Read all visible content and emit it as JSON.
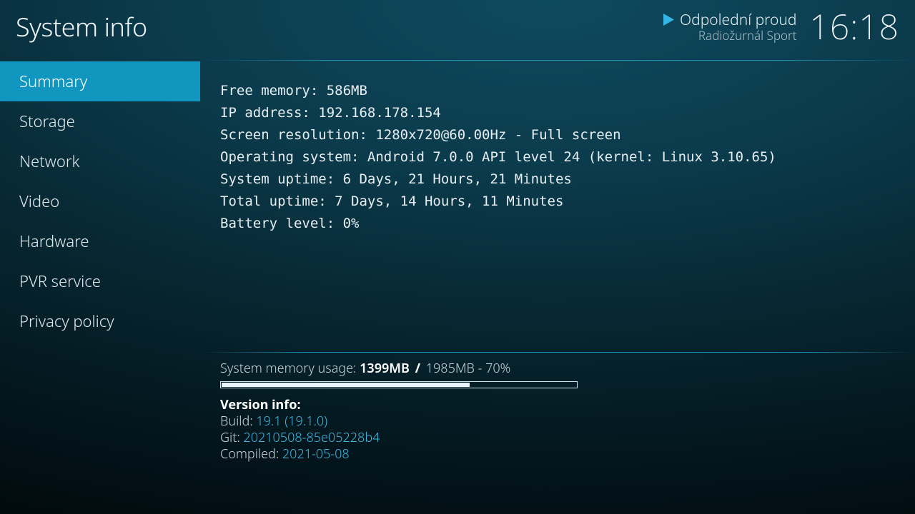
{
  "header": {
    "title": "System info",
    "now_playing": {
      "line1": "Odpolední proud",
      "line2": "Radiožurnál Sport"
    },
    "clock": "16:18"
  },
  "sidebar": {
    "items": [
      {
        "label": "Summary",
        "selected": true
      },
      {
        "label": "Storage",
        "selected": false
      },
      {
        "label": "Network",
        "selected": false
      },
      {
        "label": "Video",
        "selected": false
      },
      {
        "label": "Hardware",
        "selected": false
      },
      {
        "label": "PVR service",
        "selected": false
      },
      {
        "label": "Privacy policy",
        "selected": false
      }
    ]
  },
  "summary": {
    "lines": [
      "Free memory: 586MB",
      "IP address: 192.168.178.154",
      "Screen resolution: 1280x720@60.00Hz - Full screen",
      "Operating system: Android 7.0.0 API level 24 (kernel: Linux 3.10.65)",
      "System uptime: 6 Days, 21 Hours, 21 Minutes",
      "Total uptime: 7 Days, 14 Hours, 11 Minutes",
      "Battery level: 0%"
    ]
  },
  "footer": {
    "memory": {
      "label": "System memory usage: ",
      "used": "1399MB",
      "total": "1985MB",
      "pct_text": "70%",
      "pct_value": 70
    },
    "version": {
      "heading": "Version info:",
      "build_label": "Build: ",
      "build_value": "19.1 (19.1.0)",
      "git_label": "Git: ",
      "git_value": "20210508-85e05228b4",
      "compiled_label": "Compiled: ",
      "compiled_value": "2021-05-08"
    }
  },
  "colors": {
    "accent": "#1196bf",
    "link": "#3fb6dc"
  }
}
